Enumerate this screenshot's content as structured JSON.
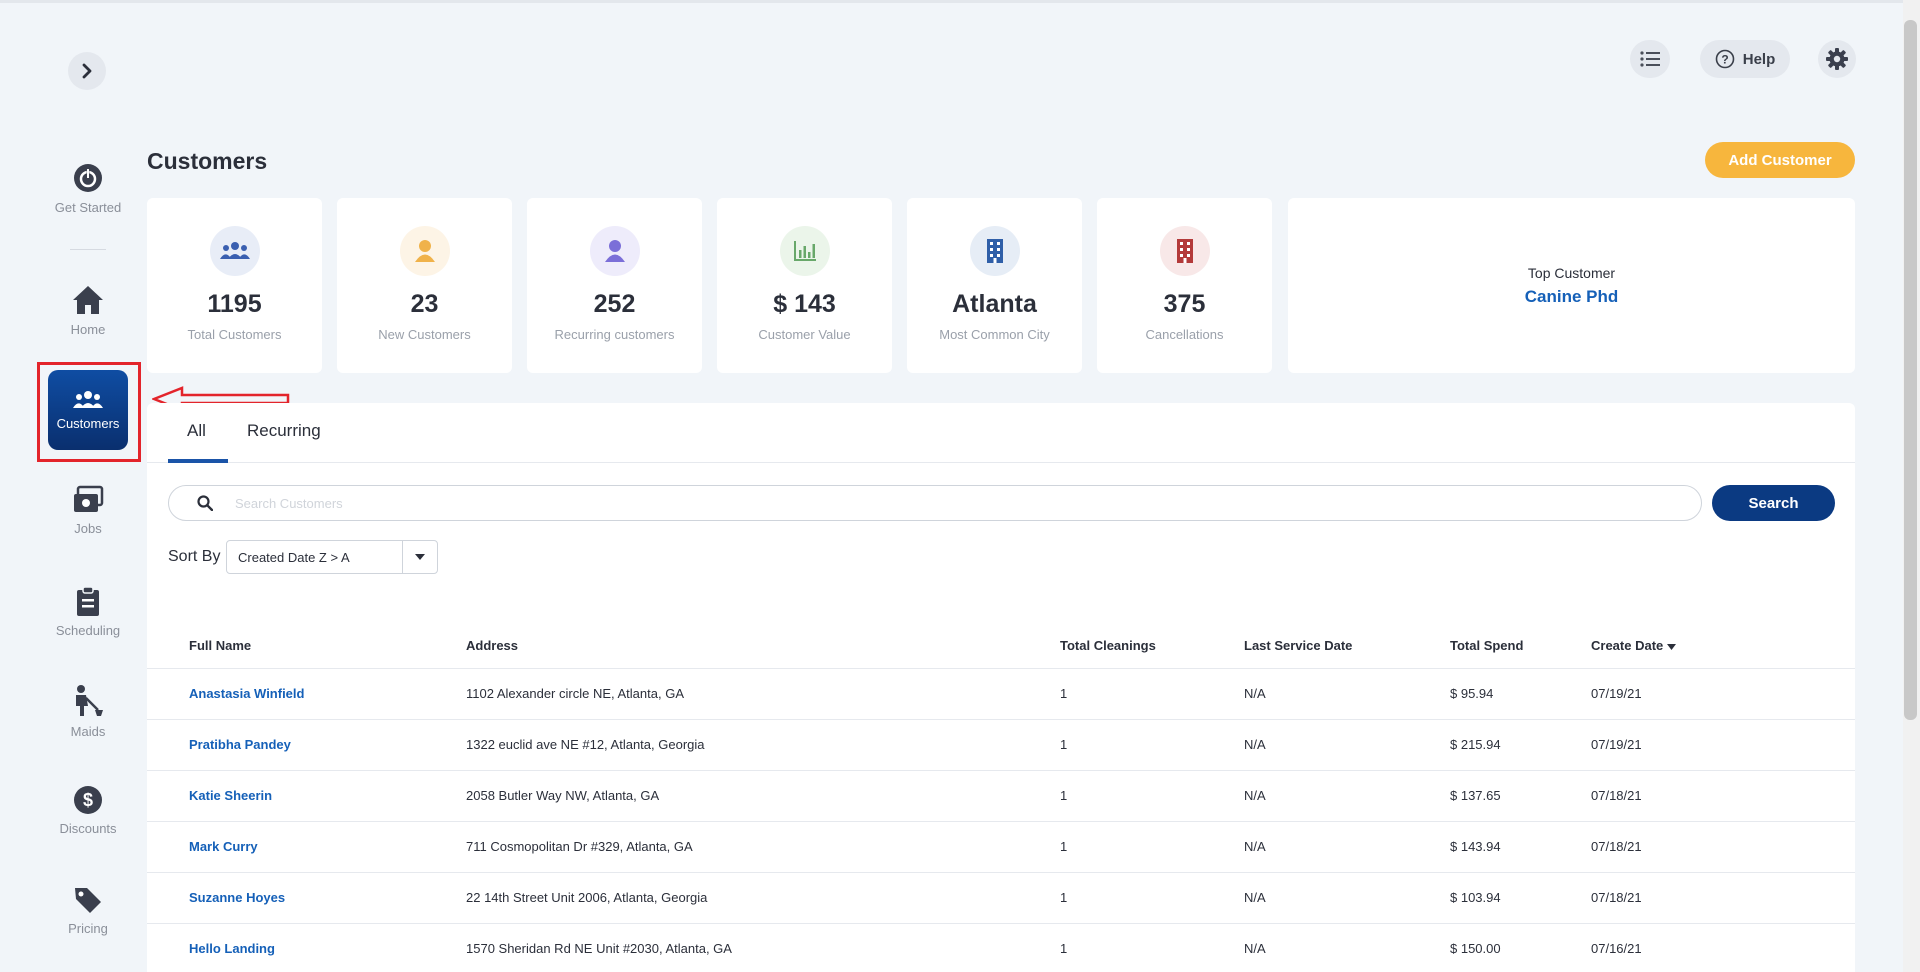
{
  "sidebar": {
    "items": [
      {
        "label": "Get Started",
        "icon": "power-icon"
      },
      {
        "label": "Home",
        "icon": "home-icon"
      },
      {
        "label": "Customers",
        "icon": "users-icon"
      },
      {
        "label": "Jobs",
        "icon": "jobs-icon"
      },
      {
        "label": "Scheduling",
        "icon": "clipboard-icon"
      },
      {
        "label": "Maids",
        "icon": "maid-icon"
      },
      {
        "label": "Discounts",
        "icon": "dollar-icon"
      },
      {
        "label": "Pricing",
        "icon": "tag-icon"
      }
    ]
  },
  "header": {
    "help_label": "Help"
  },
  "page": {
    "title": "Customers",
    "add_button": "Add Customer"
  },
  "stats": [
    {
      "value": "1195",
      "label": "Total Customers",
      "color": "#3a5fb0",
      "bg": "#e8edf7"
    },
    {
      "value": "23",
      "label": "New Customers",
      "color": "#f0b24a",
      "bg": "#fdf4e6"
    },
    {
      "value": "252",
      "label": "Recurring customers",
      "color": "#7b6fd8",
      "bg": "#eeecfb"
    },
    {
      "value": "$ 143",
      "label": "Customer Value",
      "color": "#68a86a",
      "bg": "#ebf5ea"
    },
    {
      "value": "Atlanta",
      "label": "Most Common City",
      "color": "#2f5fa8",
      "bg": "#e6edf6"
    },
    {
      "value": "375",
      "label": "Cancellations",
      "color": "#b33a3a",
      "bg": "#f8e8e8"
    }
  ],
  "top_customer": {
    "label": "Top Customer",
    "name": "Canine Phd"
  },
  "tabs": [
    {
      "label": "All",
      "active": true
    },
    {
      "label": "Recurring",
      "active": false
    }
  ],
  "search": {
    "placeholder": "Search Customers",
    "button": "Search"
  },
  "sort": {
    "label": "Sort By",
    "value": "Created Date Z > A"
  },
  "table": {
    "headers": [
      "Full Name",
      "Address",
      "Total Cleanings",
      "Last Service Date",
      "Total Spend",
      "Create Date"
    ],
    "rows": [
      [
        "Anastasia Winfield",
        "1102 Alexander circle NE, Atlanta, GA",
        "1",
        "N/A",
        "$ 95.94",
        "07/19/21"
      ],
      [
        "Pratibha Pandey",
        "1322 euclid ave NE #12, Atlanta, Georgia",
        "1",
        "N/A",
        "$ 215.94",
        "07/19/21"
      ],
      [
        "Katie Sheerin",
        "2058 Butler Way NW, Atlanta, GA",
        "1",
        "N/A",
        "$ 137.65",
        "07/18/21"
      ],
      [
        "Mark Curry",
        "711 Cosmopolitan Dr #329, Atlanta, GA",
        "1",
        "N/A",
        "$ 143.94",
        "07/18/21"
      ],
      [
        "Suzanne Hoyes",
        "22 14th Street Unit 2006, Atlanta, Georgia",
        "1",
        "N/A",
        "$ 103.94",
        "07/18/21"
      ],
      [
        "Hello Landing",
        "1570 Sheridan Rd NE Unit #2030, Atlanta, GA",
        "1",
        "N/A",
        "$ 150.00",
        "07/16/21"
      ]
    ]
  }
}
